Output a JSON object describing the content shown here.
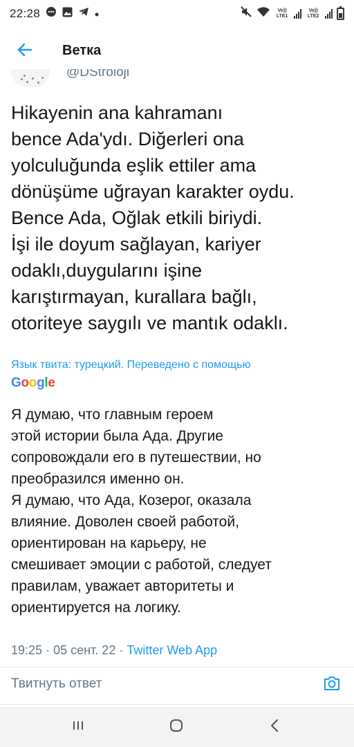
{
  "status_bar": {
    "time": "22:28",
    "net1_label": "Vo)) LTE1",
    "net2_label": "Vo)) LTE2",
    "battery_level": 0.6
  },
  "header": {
    "title": "Ветка"
  },
  "tweet": {
    "handle": "@DStroloji",
    "text": "Hikayenin ana kahramanı\nbence Ada'ydı. Diğerleri ona\nyolculuğunda eşlik ettiler ama\ndönüşüme uğrayan karakter oydu.\nBence Ada, Oğlak etkili biriydi.\nİşi ile doyum sağlayan, kariyer\nodaklı,duygularını işine\nkarıştırmayan, kurallara bağlı,\notoriteye saygılı ve mantık odaklı.",
    "translate_note": "Язык твита: турецкий. Переведено с помощью",
    "translator_brand": "Google",
    "translated_text": "Я думаю, что главным героем\nэтой истории была Ада. Другие\nсопровождали его в путешествии, но\nпреобразился именно он.\nЯ думаю, что Ада, Козерог, оказала\nвлияние. Доволен своей работой,\nориентирован на карьеру, не\nсмешивает эмоции с работой, следует\nправилам, уважает авторитеты и\nориентируется на логику.",
    "time": "19:25",
    "date": "05 сент. 22",
    "separator": "·",
    "app": "Twitter Web App"
  },
  "reply": {
    "placeholder": "Твитнуть ответ"
  },
  "colors": {
    "accent": "#1d9bf0",
    "text": "#14171a",
    "muted": "#657786"
  },
  "icons": {
    "back": "arrow-left-icon",
    "camera": "camera-icon",
    "recents": "recents-icon",
    "home": "home-icon",
    "nav_back": "chevron-left-icon"
  }
}
